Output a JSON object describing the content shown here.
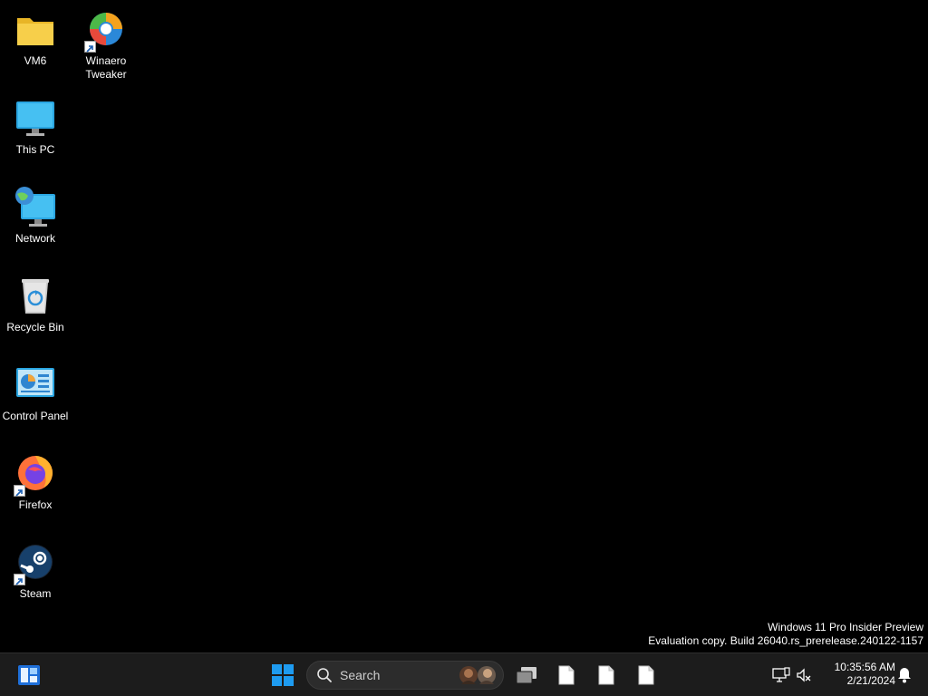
{
  "desktop": {
    "icons": [
      {
        "label": "VM6",
        "icon": "folder-icon"
      },
      {
        "label": "Winaero Tweaker",
        "icon": "winaero-tweaker-icon"
      },
      {
        "label": "This PC",
        "icon": "this-pc-icon"
      },
      {
        "label": "Network",
        "icon": "network-icon"
      },
      {
        "label": "Recycle Bin",
        "icon": "recycle-bin-icon"
      },
      {
        "label": "Control Panel",
        "icon": "control-panel-icon"
      },
      {
        "label": "Firefox",
        "icon": "firefox-icon"
      },
      {
        "label": "Steam",
        "icon": "steam-icon"
      }
    ],
    "watermark": {
      "line1": "Windows 11 Pro Insider Preview",
      "line2": "Evaluation copy. Build 26040.rs_prerelease.240122-1157"
    }
  },
  "taskbar": {
    "search": {
      "placeholder": "Search"
    },
    "clock": {
      "time": "10:35:56 AM",
      "date": "2/21/2024"
    },
    "colors": {
      "background": "#1c1c1c",
      "accent": "#1e9bf0"
    }
  }
}
